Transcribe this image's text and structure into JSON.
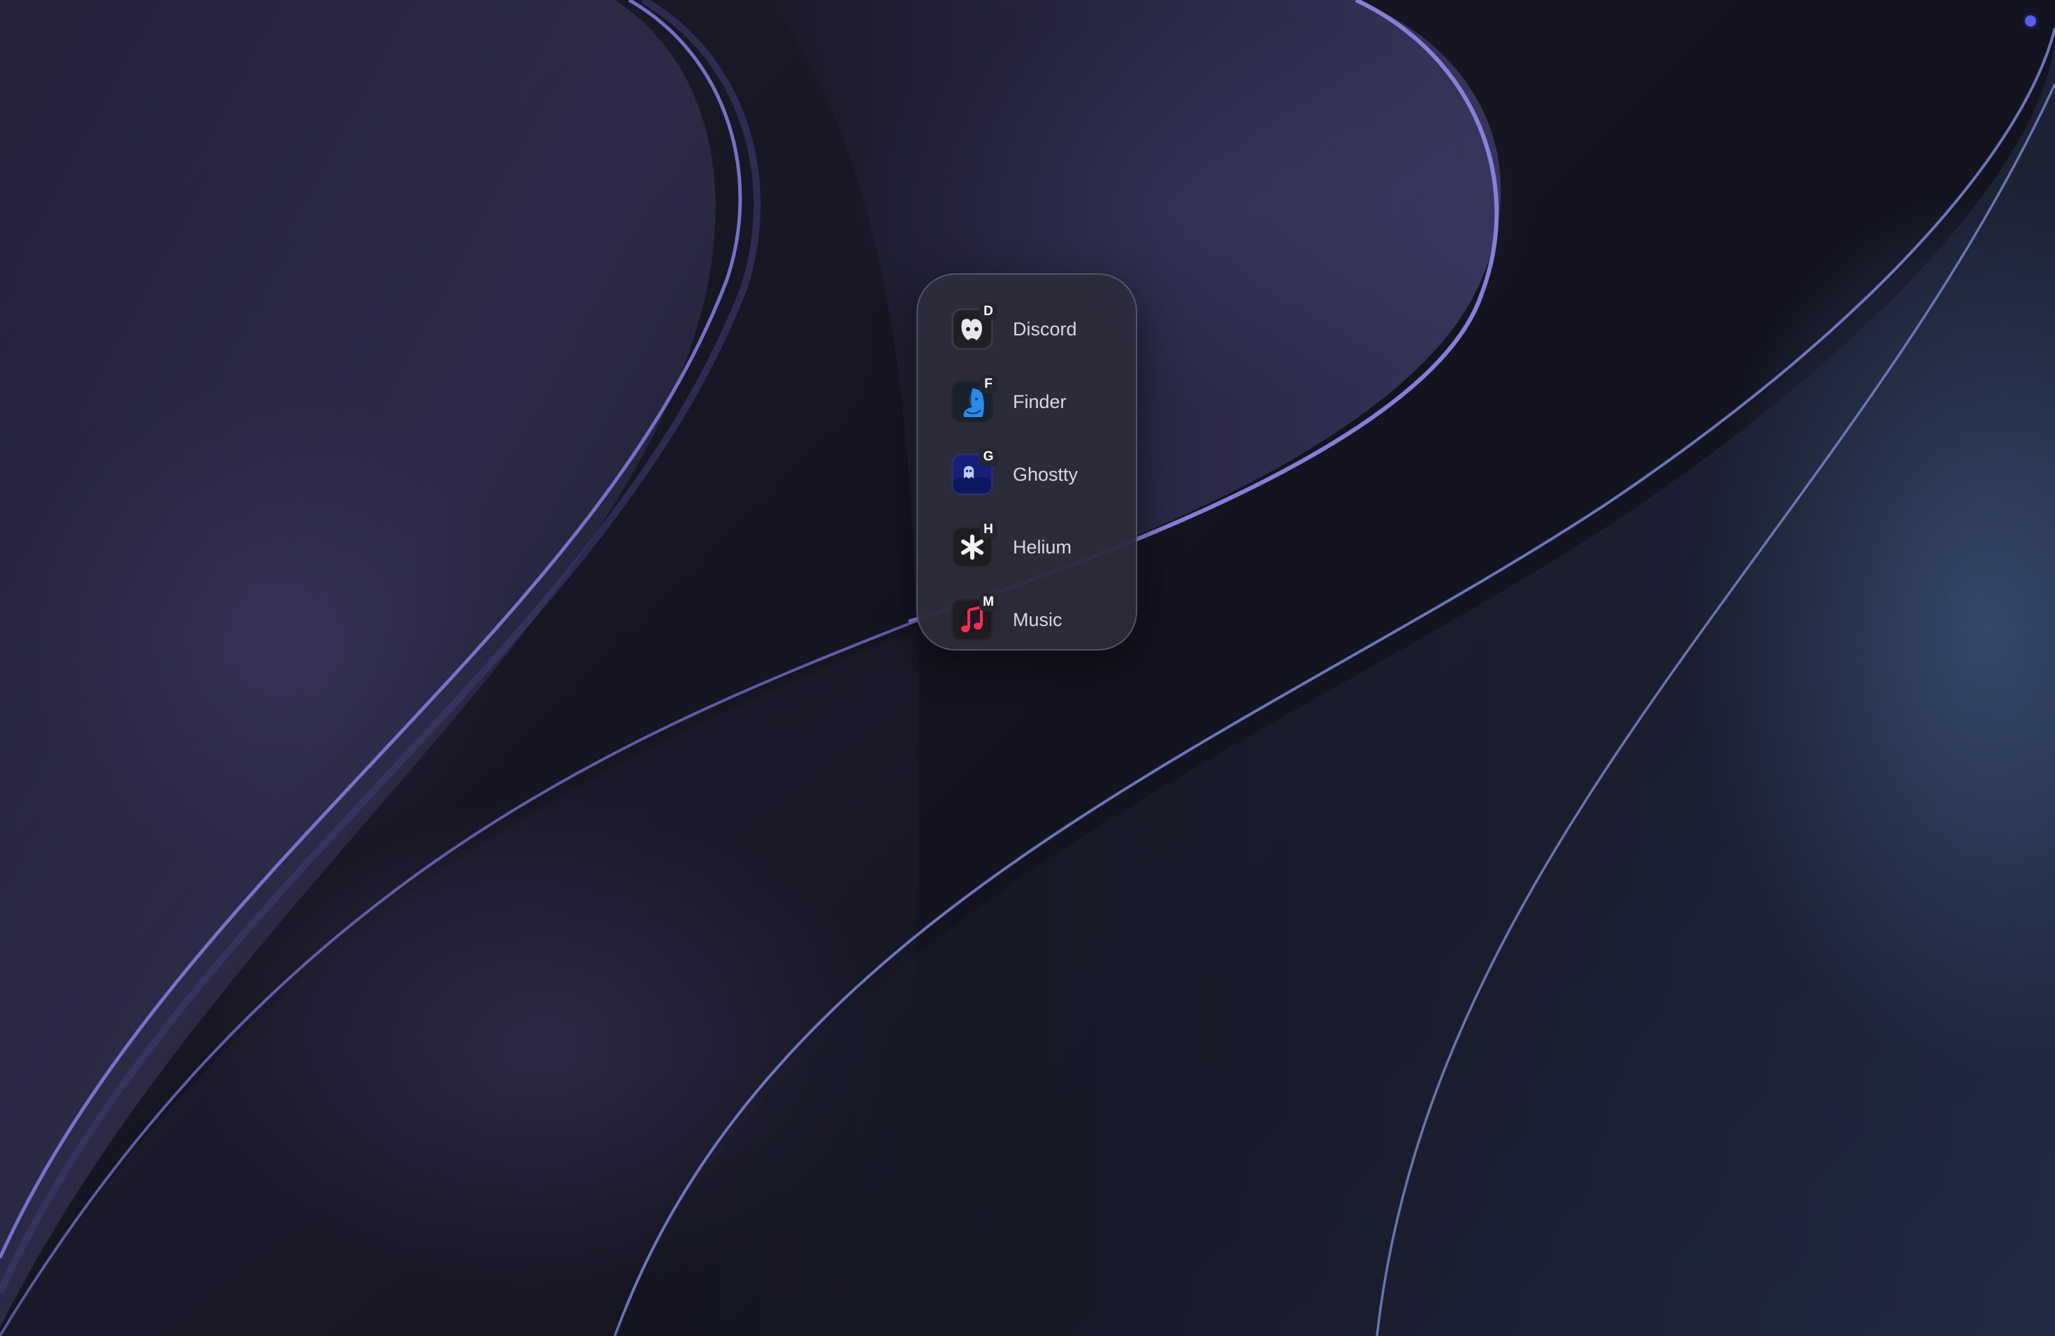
{
  "app_switcher": {
    "apps": [
      {
        "name": "Discord",
        "hotkey": "D",
        "icon": "discord-icon"
      },
      {
        "name": "Finder",
        "hotkey": "F",
        "icon": "finder-icon"
      },
      {
        "name": "Ghostty",
        "hotkey": "G",
        "icon": "ghostty-icon"
      },
      {
        "name": "Helium",
        "hotkey": "H",
        "icon": "helium-icon"
      },
      {
        "name": "Music",
        "hotkey": "M",
        "icon": "music-icon"
      }
    ]
  },
  "colors": {
    "switcher_background": "#2c2c3a",
    "wallpaper_base": "#15141f",
    "wave_highlight": "#8a86e0",
    "status_dot": "#5a5cf0"
  }
}
